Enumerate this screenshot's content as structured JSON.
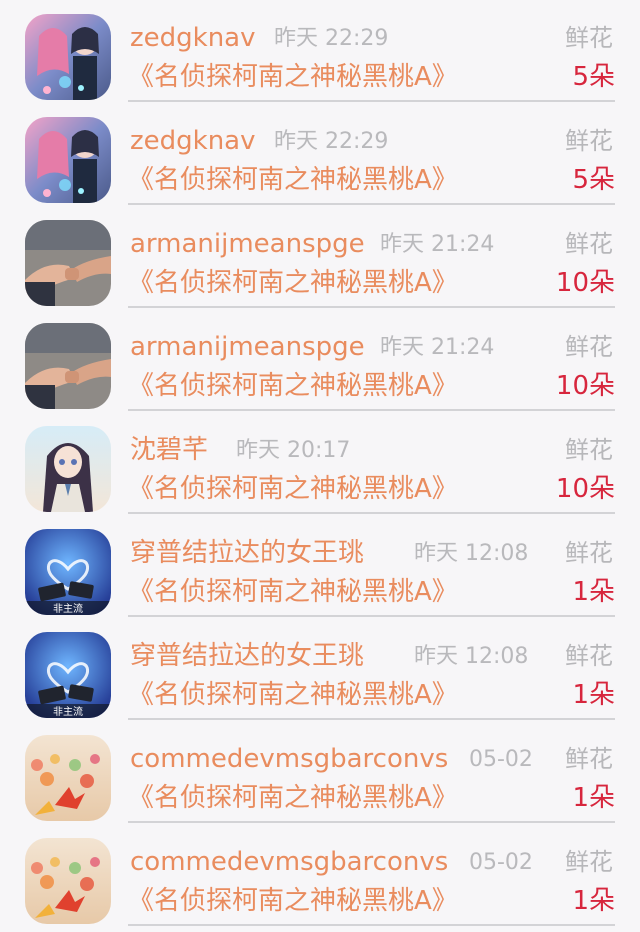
{
  "gift_list": {
    "rows": [
      {
        "name": "zedgknav",
        "time": "昨天 22:29",
        "gift": "鲜花",
        "work": "《名侦探柯南之神秘黑桃A》",
        "count": "5朵",
        "avatar": "anime-couple"
      },
      {
        "name": "zedgknav",
        "time": "昨天 22:29",
        "gift": "鲜花",
        "work": "《名侦探柯南之神秘黑桃A》",
        "count": "5朵",
        "avatar": "anime-couple"
      },
      {
        "name": "armanijmeanspge",
        "time": "昨天 21:24",
        "gift": "鲜花",
        "work": "《名侦探柯南之神秘黑桃A》",
        "count": "10朵",
        "avatar": "holding-hands"
      },
      {
        "name": "armanijmeanspge",
        "time": "昨天 21:24",
        "gift": "鲜花",
        "work": "《名侦探柯南之神秘黑桃A》",
        "count": "10朵",
        "avatar": "holding-hands"
      },
      {
        "name": "沈碧芊",
        "time": "昨天 20:17",
        "gift": "鲜花",
        "work": "《名侦探柯南之神秘黑桃A》",
        "count": "10朵",
        "avatar": "anime-girl"
      },
      {
        "name": "穿普结拉达的女王珧",
        "time": "昨天 12:08",
        "gift": "鲜花",
        "work": "《名侦探柯南之神秘黑桃A》",
        "count": "1朵",
        "avatar": "lighter-heart",
        "avatar_caption": "非主流"
      },
      {
        "name": "穿普结拉达的女王珧",
        "time": "昨天 12:08",
        "gift": "鲜花",
        "work": "《名侦探柯南之神秘黑桃A》",
        "count": "1朵",
        "avatar": "lighter-heart",
        "avatar_caption": "非主流"
      },
      {
        "name": "commedevmsgbarconvs",
        "time": "05-02",
        "gift": "鲜花",
        "work": "《名侦探柯南之神秘黑桃A》",
        "count": "1朵",
        "avatar": "paper-cranes"
      },
      {
        "name": "commedevmsgbarconvs",
        "time": "05-02",
        "gift": "鲜花",
        "work": "《名侦探柯南之神秘黑桃A》",
        "count": "1朵",
        "avatar": "paper-cranes"
      }
    ]
  },
  "colors": {
    "name": "#e98c5e",
    "work_title": "#e98c5e",
    "count": "#d7263d",
    "muted_text": "#b9b9bc",
    "divider": "#d3d3d6",
    "background": "#f7f6f8"
  }
}
